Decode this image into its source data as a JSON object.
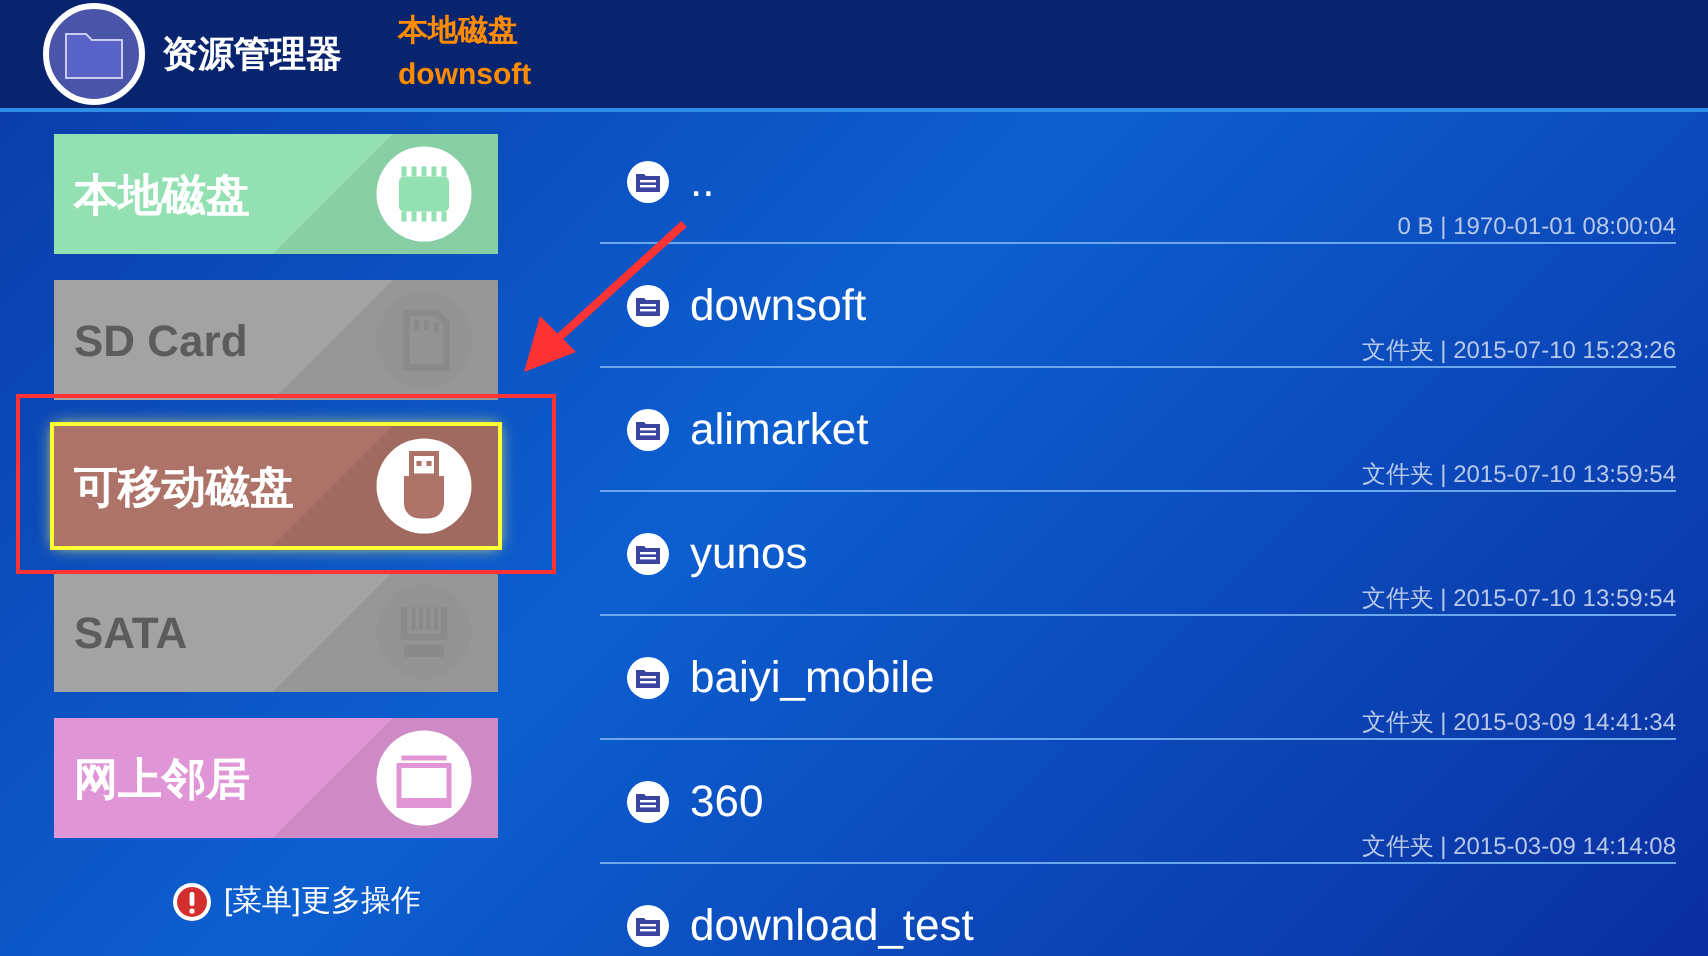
{
  "header": {
    "app_title": "资源管理器",
    "location": "本地磁盘",
    "path": "downsoft"
  },
  "sidebar": {
    "items": [
      {
        "label": "本地磁盘",
        "kind": "chip",
        "color": "#93e0b3",
        "selected": false,
        "disabled": false
      },
      {
        "label": "SD Card",
        "kind": "sdcard",
        "color": "#a3a3a3",
        "selected": false,
        "disabled": true
      },
      {
        "label": "可移动磁盘",
        "kind": "usb",
        "color": "#ad7368",
        "selected": true,
        "disabled": false
      },
      {
        "label": "SATA",
        "kind": "sata",
        "color": "#a3a3a3",
        "selected": false,
        "disabled": true
      },
      {
        "label": "网上邻居",
        "kind": "network",
        "color": "#e096d6",
        "selected": false,
        "disabled": false
      }
    ],
    "hint": "[菜单]更多操作"
  },
  "files": [
    {
      "name": "..",
      "meta": "0 B | 1970-01-01 08:00:04"
    },
    {
      "name": "downsoft",
      "meta": "文件夹 | 2015-07-10 15:23:26"
    },
    {
      "name": "alimarket",
      "meta": "文件夹 | 2015-07-10 13:59:54"
    },
    {
      "name": "yunos",
      "meta": "文件夹 | 2015-07-10 13:59:54"
    },
    {
      "name": "baiyi_mobile",
      "meta": "文件夹 | 2015-03-09 14:41:34"
    },
    {
      "name": "360",
      "meta": "文件夹 | 2015-03-09 14:14:08"
    },
    {
      "name": "download_test"
    }
  ]
}
